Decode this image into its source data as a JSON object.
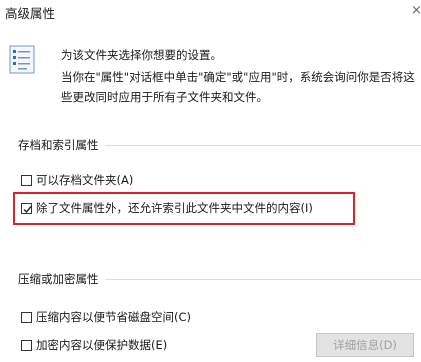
{
  "dialog": {
    "title": "高级属性",
    "close_symbol": "×"
  },
  "description": {
    "line1": "为该文件夹选择你想要的设置。",
    "line2": "当你在\"属性\"对话框中单击\"确定\"或\"应用\"时，系统会询问你是否将这",
    "line3": "些更改同时应用于所有子文件夹和文件。"
  },
  "archive_group": {
    "title": "存档和索引属性",
    "options": [
      {
        "label": "可以存档文件夹(A)",
        "checked": false
      },
      {
        "label": "除了文件属性外，还允许索引此文件夹中文件的内容(I)",
        "checked": true
      }
    ]
  },
  "compress_group": {
    "title": "压缩或加密属性",
    "options": [
      {
        "label": "压缩内容以便节省磁盘空间(C)",
        "checked": false
      },
      {
        "label": "加密内容以便保护数据(E)",
        "checked": false
      }
    ],
    "details_button": "详细信息(D)"
  },
  "colors": {
    "highlight": "#e0212a",
    "accent": "#2b6cc4"
  },
  "icons": {
    "folder_settings": "document-list-icon",
    "check": "check-icon"
  }
}
